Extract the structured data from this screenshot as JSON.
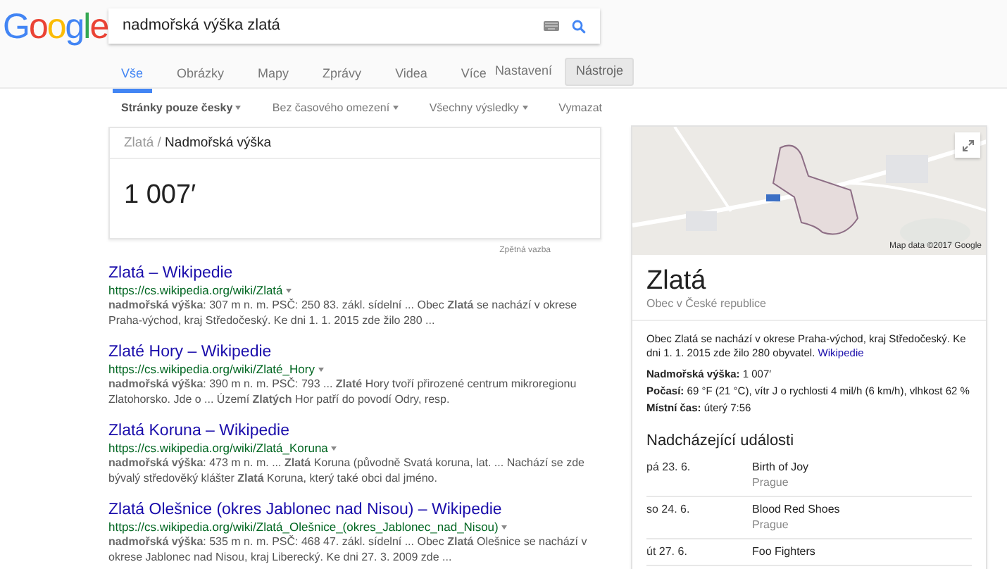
{
  "logo": "Google",
  "search": {
    "value": "nadmořská výška zlatá"
  },
  "tabs": [
    {
      "label": "Vše",
      "selected": true
    },
    {
      "label": "Obrázky",
      "selected": false
    },
    {
      "label": "Mapy",
      "selected": false
    },
    {
      "label": "Zprávy",
      "selected": false
    },
    {
      "label": "Videa",
      "selected": false
    },
    {
      "label": "Více",
      "selected": false
    }
  ],
  "settings_link": "Nastavení",
  "tools_button": {
    "label": "Nástroje",
    "pressed": true
  },
  "filters": [
    {
      "label": "Stránky pouze česky",
      "active": true,
      "menu": true
    },
    {
      "label": "Bez časového omezení",
      "active": false,
      "menu": true
    },
    {
      "label": "Všechny výsledky",
      "active": false,
      "menu": true
    },
    {
      "label": "Vymazat",
      "active": false,
      "menu": false
    }
  ],
  "answer": {
    "parent": "Zlatá",
    "separator": "/",
    "current": "Nadmořská výška",
    "value": "1 007′",
    "feedback": "Zpětná vazba"
  },
  "results": [
    {
      "title": "Zlatá – Wikipedie",
      "url": "https://cs.wikipedia.org/wiki/Zlatá",
      "snippet": "**nadmořská výška**: 307 m n. m. PSČ: 250 83. zákl. sídelní ... Obec **Zlatá** se nachází v okrese Praha-východ, kraj Středočeský. Ke dni 1. 1. 2015 zde žilo 280 ..."
    },
    {
      "title": "Zlaté Hory – Wikipedie",
      "url": "https://cs.wikipedia.org/wiki/Zlaté_Hory",
      "snippet": "**nadmořská výška**: 390 m n. m. PSČ: 793 ... **Zlaté** Hory tvoří přirozené centrum mikroregionu Zlatohorsko. Jde o ... Území **Zlatých** Hor patří do povodí Odry, resp."
    },
    {
      "title": "Zlatá Koruna – Wikipedie",
      "url": "https://cs.wikipedia.org/wiki/Zlatá_Koruna",
      "snippet": "**nadmořská výška**: 473 m n. m. ... **Zlatá** Koruna (původně Svatá koruna, lat. ... Nachází se zde bývalý středověký klášter **Zlatá** Koruna, který také obci dal jméno."
    },
    {
      "title": "Zlatá Olešnice (okres Jablonec nad Nisou) – Wikipedie",
      "url": "https://cs.wikipedia.org/wiki/Zlatá_Olešnice_(okres_Jablonec_nad_Nisou)",
      "snippet": "**nadmořská výška**: 535 m n. m. PSČ: 468 47. zákl. sídelní ... Obec **Zlatá** Olešnice se nachází v okrese Jablonec nad Nisou, kraj Liberecký. Ke dni 27. 3. 2009 zde ..."
    }
  ],
  "panel": {
    "map_attribution": "Map data ©2017 Google",
    "title": "Zlatá",
    "subtitle": "Obec v České republice",
    "description": "Obec Zlatá se nachází v okrese Praha-východ, kraj Středočeský. Ke dni 1. 1. 2015 zde žilo 280 obyvatel.",
    "source_link": "Wikipedie",
    "facts": [
      "**Nadmořská výška:** 1 007′",
      "**Počasí:** 69 °F (21 °C), vítr J o rychlosti 4 mil/h (6 km/h), vlhkost 62 %",
      "**Místní čas:** úterý 7:56"
    ],
    "events_heading": "Nadcházející události",
    "events": [
      {
        "date": "pá 23. 6.",
        "name": "Birth of Joy",
        "place": "Prague"
      },
      {
        "date": "so 24. 6.",
        "name": "Blood Red Shoes",
        "place": "Prague"
      },
      {
        "date": "út 27. 6.",
        "name": "Foo Fighters"
      }
    ]
  }
}
